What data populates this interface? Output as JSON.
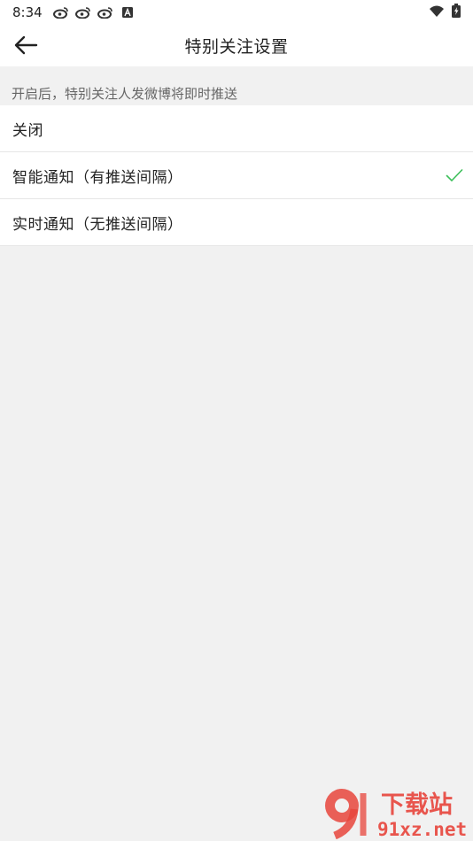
{
  "status_bar": {
    "time": "8:34",
    "notification_icons": [
      "weibo-icon",
      "weibo-icon",
      "weibo-icon",
      "a-icon"
    ],
    "right_icons": [
      "wifi-icon",
      "battery-charging-icon"
    ]
  },
  "nav": {
    "title": "特别关注设置",
    "back_icon": "arrow-left-icon"
  },
  "hint": "开启后，特别关注人发微博将即时推送",
  "options": [
    {
      "label": "关闭",
      "selected": false
    },
    {
      "label": "智能通知（有推送间隔）",
      "selected": true
    },
    {
      "label": "实时通知（无推送间隔）",
      "selected": false
    }
  ],
  "watermark": {
    "top_text": "下载站",
    "bottom_text": "91xz.net",
    "logo": "9"
  },
  "colors": {
    "check": "#3cbf5a",
    "watermark_red": "#e8453c",
    "background": "#f1f1f1"
  }
}
